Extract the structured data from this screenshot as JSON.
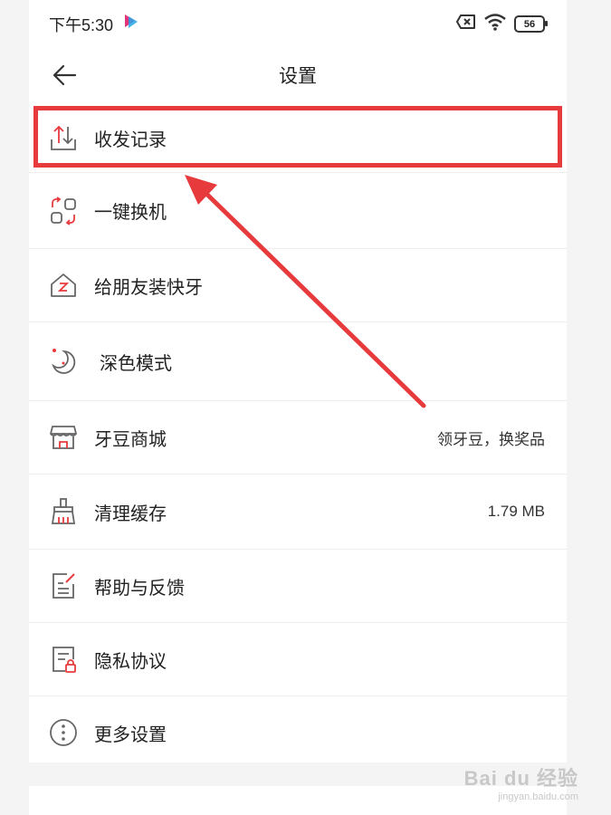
{
  "status_bar": {
    "time": "下午5:30",
    "battery": "56"
  },
  "nav": {
    "title": "设置"
  },
  "menu": {
    "items": [
      {
        "label": "收发记录",
        "icon": "send-receive-icon"
      },
      {
        "label": "一键换机",
        "icon": "phone-switch-icon"
      },
      {
        "label": "给朋友装快牙",
        "icon": "home-z-icon"
      },
      {
        "label": "深色模式",
        "icon": "moon-icon"
      },
      {
        "label": "牙豆商城",
        "icon": "store-icon",
        "value": "领牙豆，换奖品"
      },
      {
        "label": "清理缓存",
        "icon": "broom-icon",
        "value": "1.79 MB"
      },
      {
        "label": "帮助与反馈",
        "icon": "feedback-doc-icon"
      },
      {
        "label": "隐私协议",
        "icon": "privacy-doc-icon"
      },
      {
        "label": "更多设置",
        "icon": "more-dots-icon"
      }
    ]
  },
  "watermark": {
    "main": "Bai du 经验",
    "sub": "jingyan.baidu.com"
  },
  "colors": {
    "accent": "#e73a3c",
    "icon_gray": "#555555",
    "background": "#f4f4f4"
  }
}
